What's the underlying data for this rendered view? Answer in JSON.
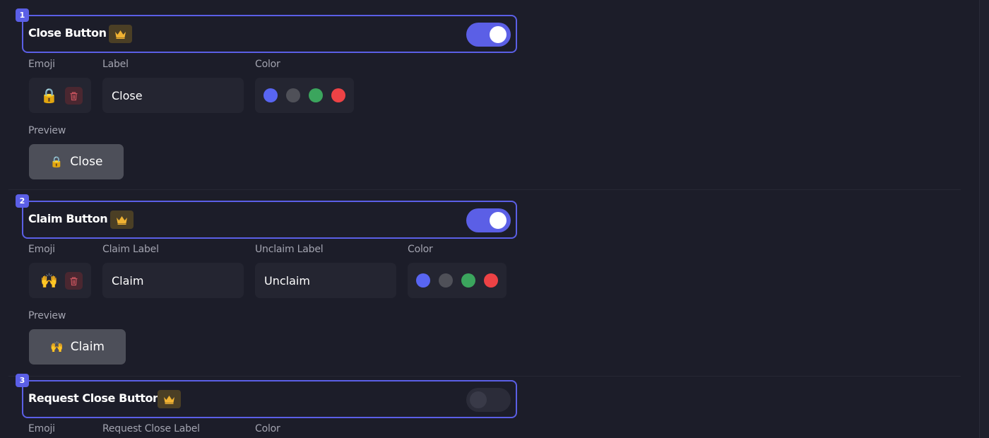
{
  "sections": [
    {
      "number": "1",
      "title": "Close Button",
      "enabled": true,
      "emoji_label": "Emoji",
      "emoji": "🔒",
      "label_caption": "Label",
      "label_value": "Close",
      "color_caption": "Color",
      "preview_caption": "Preview",
      "preview_emoji": "🔒",
      "preview_text": "Close"
    },
    {
      "number": "2",
      "title": "Claim Button",
      "enabled": true,
      "emoji_label": "Emoji",
      "emoji": "🙌",
      "label_caption": "Claim Label",
      "label_value": "Claim",
      "unclaim_caption": "Unclaim Label",
      "unclaim_value": "Unclaim",
      "color_caption": "Color",
      "preview_caption": "Preview",
      "preview_emoji": "🙌",
      "preview_text": "Claim"
    },
    {
      "number": "3",
      "title": "Request Close Button",
      "enabled": false,
      "emoji_label": "Emoji",
      "label_caption": "Request Close Label",
      "color_caption": "Color"
    }
  ],
  "color_options": [
    "#5865f2",
    "#4f5058",
    "#3ba55d",
    "#ed4245"
  ],
  "icons": {
    "premium": "crown-icon",
    "delete": "trash-icon"
  },
  "accent": "#5b5fe6"
}
